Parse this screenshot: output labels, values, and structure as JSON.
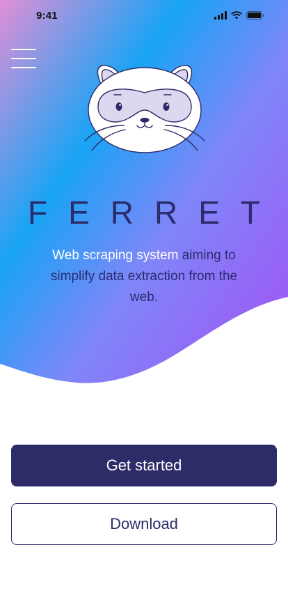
{
  "status_bar": {
    "time": "9:41"
  },
  "hero": {
    "title": "FERRET",
    "tagline_highlight": "Web scraping system",
    "tagline_rest": " aiming to simplify data extraction from the web."
  },
  "actions": {
    "primary_label": "Get started",
    "secondary_label": "Download"
  },
  "icons": {
    "menu": "hamburger-menu-icon",
    "logo": "ferret-mascot-logo",
    "signal": "cellular-signal-icon",
    "wifi": "wifi-icon",
    "battery": "battery-icon"
  },
  "colors": {
    "brand_dark": "#2d2b68",
    "gradient_pink": "#d98ad8",
    "gradient_blue": "#16a2f5",
    "gradient_purple": "#9a63f7"
  }
}
